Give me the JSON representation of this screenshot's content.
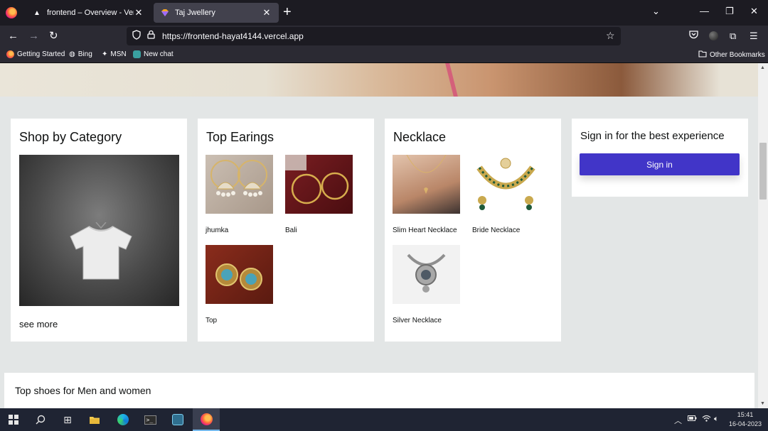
{
  "browser": {
    "tabs": [
      {
        "title": "frontend – Overview - Vercel",
        "active": false,
        "favicon": "vercel-triangle-icon"
      },
      {
        "title": "Taj Jwellery",
        "active": true,
        "favicon": "gem-icon"
      }
    ],
    "url": "https://frontend-hayat4144.vercel.app",
    "bookmarks": [
      {
        "label": "Getting Started",
        "icon": "firefox-icon"
      },
      {
        "label": "Bing",
        "icon": "globe-icon"
      },
      {
        "label": "MSN",
        "icon": "msn-butterfly-icon"
      },
      {
        "label": "New chat",
        "icon": "chat-icon"
      }
    ],
    "other_bookmarks": "Other Bookmarks"
  },
  "page": {
    "category_card": {
      "title": "Shop by Category",
      "link": "see more"
    },
    "earings_card": {
      "title": "Top Earings",
      "items": [
        {
          "label": "jhumka"
        },
        {
          "label": "Bali"
        },
        {
          "label": "Top"
        }
      ]
    },
    "necklace_card": {
      "title": "Necklace",
      "items": [
        {
          "label": "Slim Heart Necklace"
        },
        {
          "label": "Bride Necklace"
        },
        {
          "label": "Silver Necklace"
        }
      ]
    },
    "signin_card": {
      "title": "Sign in for the best experience",
      "button": "Sign in"
    },
    "shoes_section": {
      "title": "Top shoes for Men and women"
    }
  },
  "taskbar": {
    "time": "15:41",
    "date": "16-04-2023"
  },
  "colors": {
    "accent": "#4135c8",
    "page_bg": "#e3e6e6",
    "chrome_bg": "#1c1b22",
    "toolbar_bg": "#2b2a33"
  }
}
